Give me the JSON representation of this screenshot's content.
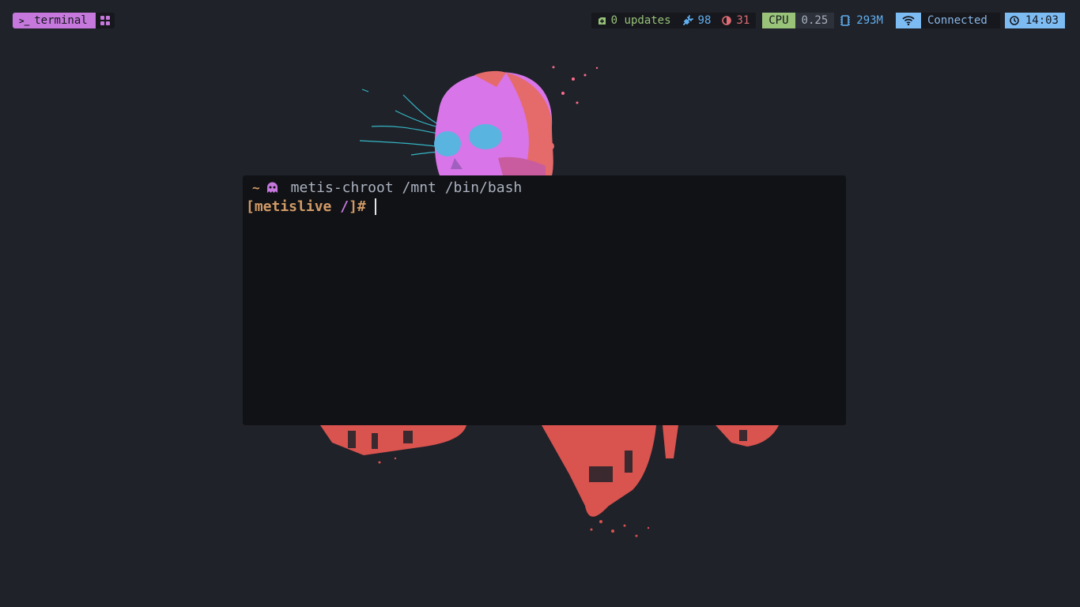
{
  "topbar": {
    "workspace": {
      "label": "terminal",
      "icon": "terminal-icon"
    },
    "apps_icon": "grid-icon",
    "updates": {
      "icon": "package-icon",
      "text": "0 updates"
    },
    "power": {
      "icon": "plug-icon",
      "value": "98"
    },
    "brightness": {
      "icon": "brightness-icon",
      "value": "31"
    },
    "cpu": {
      "label": "CPU",
      "value": "0.25"
    },
    "memory": {
      "icon": "memory-chip-icon",
      "value": "293M"
    },
    "network": {
      "icon": "wifi-icon",
      "status": "Connected"
    },
    "clock": {
      "icon": "clock-icon",
      "time": "14:03"
    }
  },
  "terminal": {
    "title_prefix": "~",
    "title_icon": "ghost-icon",
    "title": "metis-chroot /mnt /bin/bash",
    "prompt": {
      "open": "[metislive ",
      "dir": "/",
      "close": "]",
      "symbol": "#"
    }
  },
  "colors": {
    "background": "#1f2229",
    "terminal_bg": "#111216",
    "accent_purple": "#c678dd",
    "accent_green": "#98c379",
    "accent_blue": "#7dbbf3",
    "accent_orange": "#d19a66",
    "accent_red": "#e06c75"
  }
}
